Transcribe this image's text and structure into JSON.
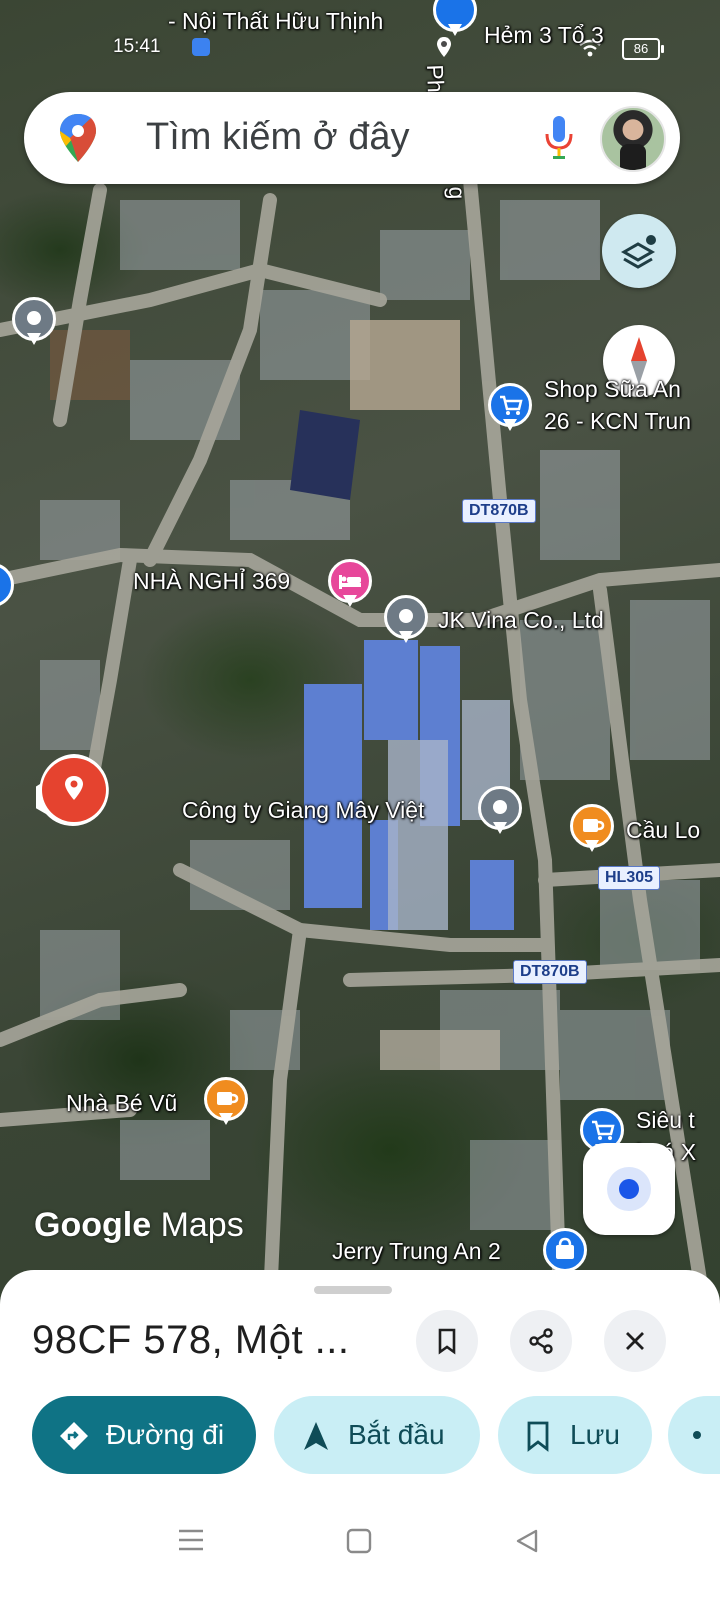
{
  "status_bar": {
    "time": "15:41",
    "battery": "86"
  },
  "search": {
    "placeholder": "Tìm kiếm ở đây"
  },
  "map": {
    "labels": {
      "top_store": "- Nội Thất Hữu Thịnh",
      "hem": "Hẻm 3 Tổ 3",
      "street_vertical": "Ph",
      "street_g": "g",
      "shop_line1": "Shop Sữa An",
      "shop_line2": "26 - KCN Trun",
      "nha_nghi": "NHÀ NGHỈ 369",
      "jk_vina": "JK Vina Co., Ltd",
      "giang_may": "Công ty Giang Mây Việt",
      "cau_lo": "Cầu Lo",
      "nha_be_vu": "Nhà Bé Vũ",
      "sieu_thi_1": "Siêu t",
      "sieu_thi_2": "hoá X",
      "jerry": "Jerry Trung An 2"
    },
    "road_tags": {
      "dt870b_top": "DT870B",
      "hl305": "HL305",
      "dt870b_bottom": "DT870B"
    },
    "logo": {
      "google": "Google",
      "maps": "Maps"
    }
  },
  "sheet": {
    "title": "98CF 578, Một ...",
    "buttons": {
      "directions": "Đường đi",
      "start": "Bắt đầu",
      "save": "Lưu"
    }
  },
  "colors": {
    "primary_teal": "#0f7385",
    "secondary_pill": "#c9eef5",
    "pin_red": "#e5432f",
    "pin_blue": "#1a73e8",
    "pin_orange": "#f08c1f",
    "pin_pink": "#e7479a",
    "pin_grey": "#6e7a85"
  }
}
